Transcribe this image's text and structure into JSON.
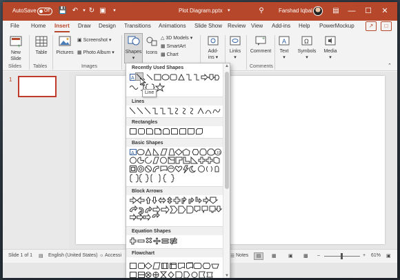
{
  "app": {
    "autosave_label": "AutoSave",
    "autosave_state": "Off",
    "file_title": "Plot Diagram.pptx",
    "user_name": "Farshad Iqbal",
    "brand_color": "#b7472a"
  },
  "quick_access": [
    "save-icon",
    "undo-icon",
    "redo-icon",
    "present-icon",
    "customize-icon"
  ],
  "tabs": [
    "File",
    "Home",
    "Insert",
    "Draw",
    "Design",
    "Transitions",
    "Animations",
    "Slide Show",
    "Review",
    "View",
    "Add-ins",
    "Help",
    "PowerMockup"
  ],
  "active_tab": "Insert",
  "ribbon": {
    "slides": {
      "new_slide": "New",
      "new_slide_2": "Slide",
      "group": "Slides"
    },
    "tables": {
      "table": "Table",
      "group": "Tables"
    },
    "images": {
      "pictures": "Pictures",
      "screenshot": "Screenshot",
      "photo_album": "Photo Album",
      "group": "Images"
    },
    "illustrations": {
      "shapes": "Shapes",
      "icons": "Icons",
      "models": "3D Models",
      "smartart": "SmartArt",
      "chart": "Chart"
    },
    "addins": {
      "label": "Add-",
      "label2": "ins"
    },
    "links": {
      "label": "Links"
    },
    "comments": {
      "comment": "Comment",
      "group": "Comments"
    },
    "text": {
      "label": "Text"
    },
    "symbols": {
      "label": "Symbols"
    },
    "media": {
      "label": "Media"
    }
  },
  "slides_panel": {
    "slide_number": "1"
  },
  "dropdown": {
    "sections": [
      "Recently Used Shapes",
      "Lines",
      "Rectangles",
      "Basic Shapes",
      "Block Arrows",
      "Equation Shapes",
      "Flowchart"
    ],
    "tooltip": "Line"
  },
  "status": {
    "slide_info": "Slide 1 of 1",
    "language": "English (United States)",
    "accessibility": "Accessi",
    "notes": "Notes",
    "zoom": "61%"
  }
}
